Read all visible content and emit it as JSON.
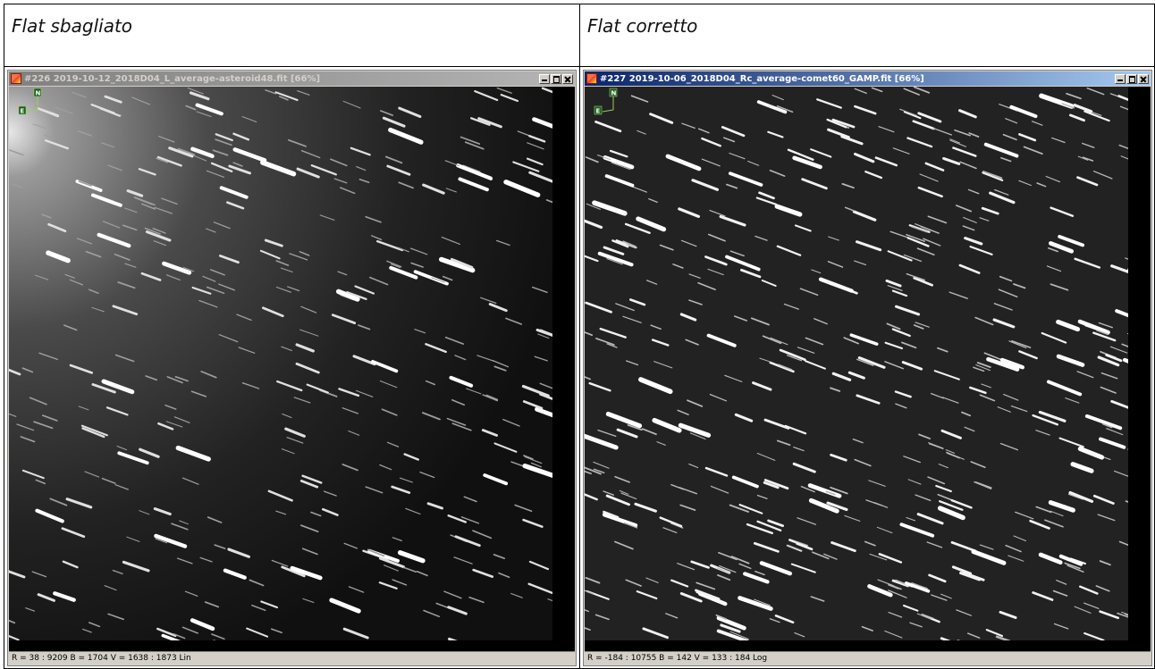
{
  "document": {
    "left_caption": "Flat sbagliato",
    "right_caption": "Flat corretto"
  },
  "left_window": {
    "title": "#226 2019-10-12_2018D04_L_average-asteroid48.fit  [66%]",
    "status": "R = 38 : 9209   B = 1704   V = 1638 : 1873 Lin",
    "compass": {
      "north": "N",
      "east": "E"
    },
    "icons": [
      "app-icon",
      "minimize-icon",
      "maximize-icon",
      "close-icon"
    ]
  },
  "right_window": {
    "title": "#227 2019-10-06_2018D04_Rc_average-comet60_GAMP.fit  [66%]",
    "status": "R = -184 : 10755   B = 142   V = 133 : 184 Log",
    "compass": {
      "north": "N",
      "east": "E"
    },
    "icons": [
      "app-icon",
      "minimize-icon",
      "maximize-icon",
      "close-icon"
    ]
  },
  "colors": {
    "inactive_title": "#808080",
    "active_title": "#0a246a",
    "window_face": "#d4d0c8",
    "compass": "#2e7d32"
  }
}
